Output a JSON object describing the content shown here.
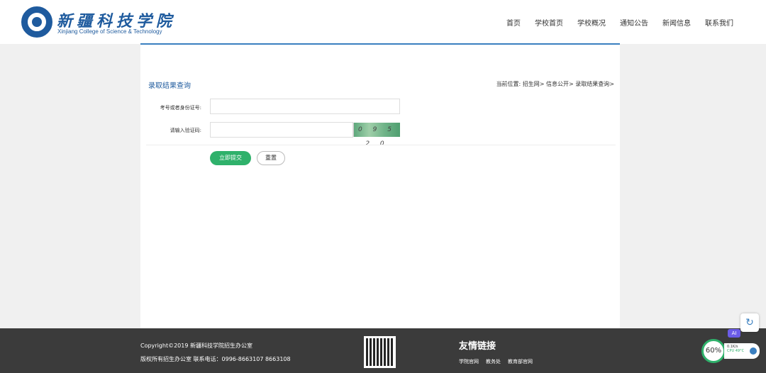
{
  "header": {
    "brand_cn": "新疆科技学院",
    "brand_en": "Xinjiang College of Science & Technology",
    "nav": [
      "首页",
      "学校首页",
      "学校概况",
      "通知公告",
      "新闻信息",
      "联系我们"
    ]
  },
  "main": {
    "section_title": "录取结果查询",
    "breadcrumb": "当前位置: 招生网> 信息公开> 录取结果查询>",
    "form": {
      "id_label": "考号或者身份证号:",
      "id_value": "",
      "code_label": "请输入验证码:",
      "code_value": "",
      "captcha_text": "0 9 5 2 0"
    },
    "submit_label": "立即提交",
    "reset_label": "重置"
  },
  "footer": {
    "copyright": "Copyright©2019 新疆科技学院招生办公室",
    "contact": "版权所有招生办公室 联系电话：0996-8663107 8663108",
    "links_title": "友情链接",
    "links": [
      "学院官网",
      "教务处",
      "教育部官网"
    ]
  },
  "widgets": {
    "ai_label": "AI",
    "percent": "60%",
    "net": "0.1K/s",
    "cpu": "CPU 49°C"
  },
  "colors": {
    "brand": "#1f5b9e",
    "accent_line": "#3a7fc0",
    "submit": "#2fb16b",
    "footer_bg": "#3b3b3b"
  }
}
